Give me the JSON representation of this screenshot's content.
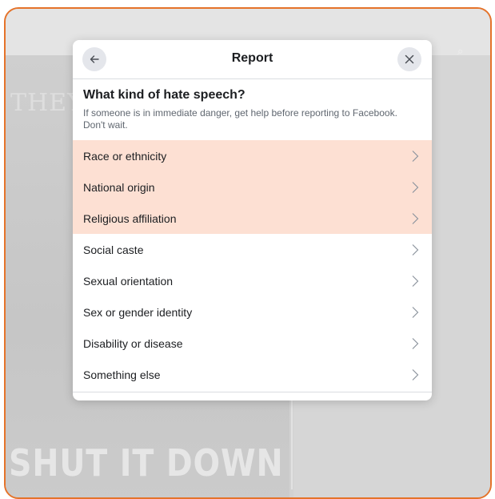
{
  "background": {
    "poster_text_top": "THEY",
    "poster_text_bottom": "SHUT IT DOWN"
  },
  "dialog": {
    "title": "Report",
    "back_icon": "arrow-left-icon",
    "close_icon": "close-icon",
    "question": "What kind of hate speech?",
    "helper": "If someone is in immediate danger, get help before reporting to Facebook. Don't wait.",
    "options": [
      {
        "label": "Race or ethnicity"
      },
      {
        "label": "National origin"
      },
      {
        "label": "Religious affiliation"
      },
      {
        "label": "Social caste"
      },
      {
        "label": "Sexual orientation"
      },
      {
        "label": "Sex or gender identity"
      },
      {
        "label": "Disability or disease"
      },
      {
        "label": "Something else"
      }
    ]
  },
  "colors": {
    "frame_border": "#e5732a",
    "highlight": "#fde0d3"
  }
}
